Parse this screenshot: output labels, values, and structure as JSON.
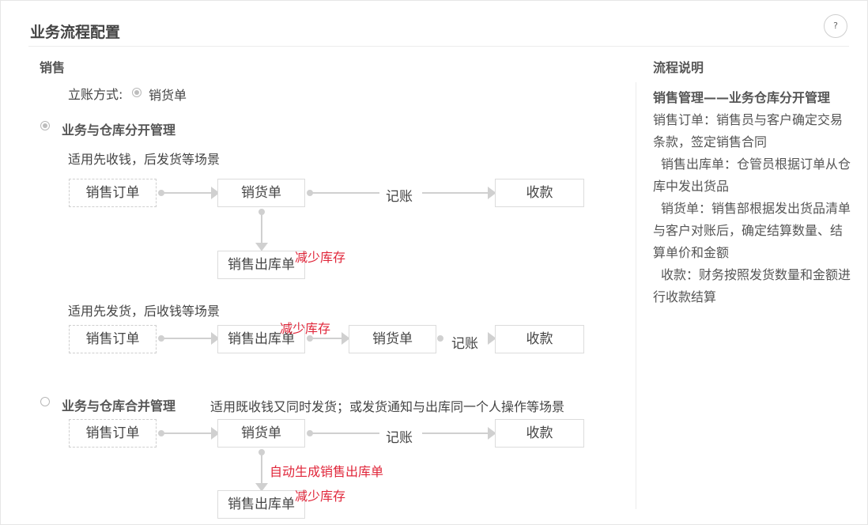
{
  "header": {
    "title": "业务流程配置",
    "help_icon": "?"
  },
  "sales": {
    "heading": "销售",
    "account_label": "立账方式:",
    "account_value": "销货单"
  },
  "option_separate": {
    "label": "业务与仓库分开管理",
    "selected": true,
    "scenario1": {
      "desc": "适用先收钱，后发货等场景",
      "order": "销售订单",
      "delivery_note": "销货单",
      "bookkeeping": "记账",
      "receipt": "收款",
      "outbound": "销售出库单",
      "reduce": "减少库存"
    },
    "scenario2": {
      "desc": "适用先发货，后收钱等场景",
      "order": "销售订单",
      "outbound": "销售出库单",
      "reduce": "减少库存",
      "delivery_note": "销货单",
      "bookkeeping": "记账",
      "receipt": "收款"
    }
  },
  "option_merged": {
    "label": "业务与仓库合并管理",
    "selected": false,
    "desc": "适用既收钱又同时发货；或发货通知与出库同一个人操作等场景",
    "order": "销售订单",
    "delivery_note": "销货单",
    "bookkeeping": "记账",
    "receipt": "收款",
    "auto_gen": "自动生成销售出库单",
    "outbound": "销售出库单",
    "reduce": "减少库存"
  },
  "explain": {
    "title": "流程说明",
    "heading": "销售管理——业务仓库分开管理",
    "items": [
      "销售订单：销售员与客户确定交易条款，签定销售合同",
      "销售出库单：仓管员根据订单从仓库中发出货品",
      "销货单：销售部根据发出货品清单与客户对账后，确定结算数量、结算单价和金额",
      "收款：财务按照发货数量和金额进行收款结算"
    ]
  },
  "colors": {
    "accent_red": "#e0263a",
    "arrow": "#d0d0d0"
  }
}
